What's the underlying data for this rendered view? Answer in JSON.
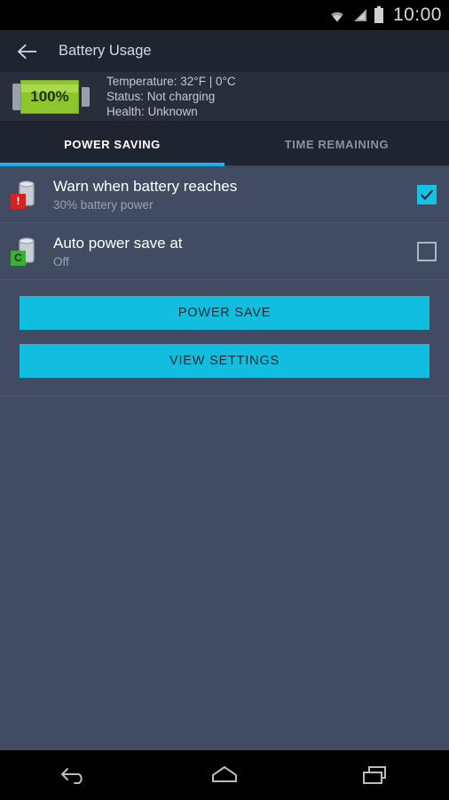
{
  "status_bar": {
    "time": "10:00",
    "icons": [
      "wifi-icon",
      "cellular-signal-icon",
      "battery-full-icon"
    ]
  },
  "action_bar": {
    "back_icon": "back-arrow-icon",
    "title": "Battery Usage"
  },
  "battery_info": {
    "percent_label": "100%",
    "percent_value": 100,
    "temperature": "Temperature: 32°F | 0°C",
    "status": "Status: Not charging",
    "health": "Health: Unknown",
    "gauge_color": "#8CC62B"
  },
  "tabs": {
    "items": [
      {
        "label": "POWER SAVING",
        "active": true
      },
      {
        "label": "TIME REMAINING",
        "active": false
      }
    ],
    "indicator_color": "#16B4E8"
  },
  "settings_rows": [
    {
      "title": "Warn when battery reaches",
      "subtitle": "30% battery power",
      "icon": "battery-warning-icon",
      "badge_glyph": "!",
      "badge_color": "#D32323",
      "checked": true
    },
    {
      "title": "Auto power save at",
      "subtitle": "Off",
      "icon": "battery-eco-icon",
      "badge_glyph": "C",
      "badge_color": "#3FAE39",
      "checked": false
    }
  ],
  "buttons": {
    "power_save": "POWER SAVE",
    "view_settings": "VIEW SETTINGS",
    "color": "#11BEE0"
  },
  "nav_bar": {
    "back": "nav-back-icon",
    "home": "nav-home-icon",
    "recents": "nav-recents-icon"
  }
}
